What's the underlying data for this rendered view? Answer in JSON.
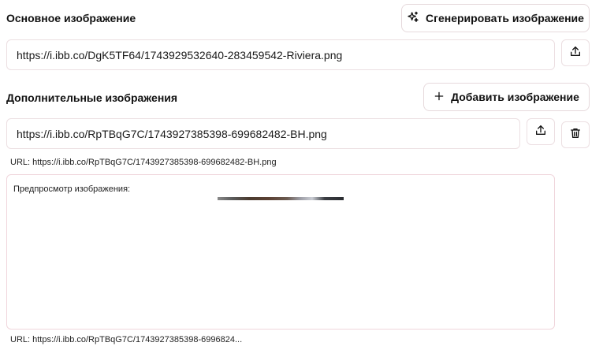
{
  "main_image": {
    "title": "Основное изображение",
    "generate_label": "Сгенерировать изображение",
    "url_value": "https://i.ibb.co/DgK5TF64/1743929532640-283459542-Riviera.png"
  },
  "additional_images": {
    "title": "Дополнительные изображения",
    "add_label": "Добавить изображение",
    "items": [
      {
        "url_value": "https://i.ibb.co/RpTBqG7C/1743927385398-699682482-BH.png",
        "url_note": "URL: https://i.ibb.co/RpTBqG7C/1743927385398-699682482-BH.png",
        "preview_label": "Предпросмотр изображения:",
        "preview_url_note": "URL: https://i.ibb.co/RpTBqG7C/1743927385398-6996824..."
      }
    ]
  },
  "colors": {
    "border": "#ecdfe2",
    "preview_border": "#f0d6dc",
    "text": "#111111"
  },
  "icons": [
    "sparkles-icon",
    "upload-icon",
    "plus-icon",
    "trash-icon"
  ]
}
